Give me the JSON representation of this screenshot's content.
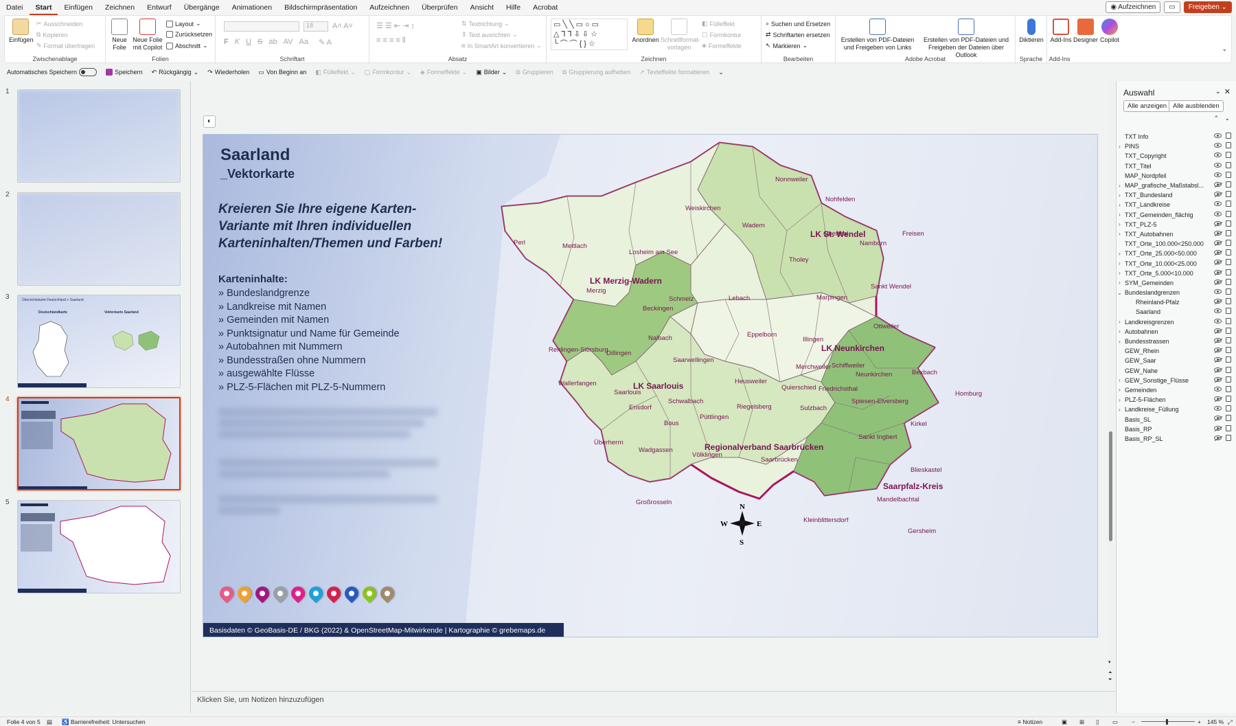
{
  "menu": {
    "tabs": [
      "Datei",
      "Start",
      "Einfügen",
      "Zeichnen",
      "Entwurf",
      "Übergänge",
      "Animationen",
      "Bildschirmpräsentation",
      "Aufzeichnen",
      "Überprüfen",
      "Ansicht",
      "Hilfe",
      "Acrobat"
    ],
    "active_tab": "Start",
    "record_label": "Aufzeichnen",
    "share_label": "Freigeben"
  },
  "ribbon": {
    "clipboard": {
      "group": "Zwischenablage",
      "paste": "Einfügen",
      "cut": "Ausschneiden",
      "copy": "Kopieren",
      "format_painter": "Format übertragen"
    },
    "slides": {
      "group": "Folien",
      "new_slide": "Neue Folie",
      "new_slide_copilot": "Neue Folie mit Copilot",
      "layout": "Layout",
      "reset": "Zurücksetzen",
      "section": "Abschnitt"
    },
    "font": {
      "group": "Schriftart",
      "size": "18",
      "bold": "F",
      "italic": "K",
      "underline": "U",
      "strike": "S",
      "shadow": "ab",
      "spacing": "AV",
      "case": "Aa"
    },
    "paragraph": {
      "group": "Absatz",
      "text_direction": "Textrichtung",
      "align_text": "Text ausrichten",
      "smartart": "In SmartArt konvertieren"
    },
    "drawing": {
      "group": "Zeichnen",
      "arrange": "Anordnen",
      "quick_styles": "Schnellformat-vorlagen",
      "fill": "Fülleffekt",
      "outline": "Formkontur",
      "effects": "Formeffekte"
    },
    "editing": {
      "group": "Bearbeiten",
      "find": "Suchen und Ersetzen",
      "replace": "Schriftarten ersetzen",
      "select": "Markieren"
    },
    "acrobat": {
      "group": "Adobe Acrobat",
      "pdf_share_links": "Erstellen von PDF-Dateien und Freigeben von Links",
      "pdf_share_outlook": "Erstellen von PDF-Dateien und Freigeben der Dateien über Outlook"
    },
    "voice": {
      "group": "Sprache",
      "dictate": "Diktieren"
    },
    "addins": {
      "group": "Add-Ins",
      "addins": "Add-Ins",
      "designer": "Designer",
      "copilot": "Copilot"
    }
  },
  "quickbar": {
    "autosave": "Automatisches Speichern",
    "save": "Speichern",
    "undo": "Rückgängig",
    "redo": "Wiederholen",
    "from_start": "Von Beginn an",
    "fill": "Fülleffekt",
    "outline": "Formkontur",
    "effects": "Formeffekte",
    "pictures": "Bilder",
    "group": "Gruppieren",
    "ungroup": "Gruppierung aufheben",
    "text_effects": "Texteffekte formatieren"
  },
  "thumbnails": {
    "numbers": [
      "1",
      "2",
      "3",
      "4",
      "5"
    ],
    "t3_title": "Übersichtskarte Deutschland + Saarland",
    "t3_left": "Deutschlandkarte",
    "t3_right": "Vektorkarte Saarland"
  },
  "slide": {
    "title": "Saarland",
    "subtitle": "_Vektorkarte",
    "claim": "Kreieren Sie Ihre eigene Karten-Variante mit Ihren individuellen Karteninhalten/Themen und Farben!",
    "content_head": "Karteninhalte:",
    "content_items": [
      "» Bundeslandgrenze",
      "» Landkreise mit Namen",
      "» Gemeinden mit Namen",
      "» Punktsignatur und Name für Gemeinde",
      "» Autobahnen mit Nummern",
      "» Bundesstraßen ohne Nummern",
      "» ausgewählte Flüsse",
      "» PLZ-5-Flächen mit PLZ-5-Nummern"
    ],
    "footer": "Basisdaten © GeoBasis-DE / BKG (2022) & OpenStreetMap-Mitwirkende | Kartographie © grebemaps.de",
    "pin_colors": [
      "#e95a86",
      "#f0a030",
      "#a0187e",
      "#9aa0a6",
      "#e0208a",
      "#1ea0d8",
      "#d81e4a",
      "#2a58c0",
      "#8ac41e",
      "#a08a6a"
    ],
    "compass": {
      "n": "N",
      "s": "S",
      "e": "E",
      "w": "W"
    }
  },
  "map": {
    "districts": [
      "LK St. Wendel",
      "LK Merzig-Wadern",
      "LK Neunkirchen",
      "LK Saarlouis",
      "Regionalverband Saarbrücken",
      "Saarpfalz-Kreis"
    ],
    "municipalities": [
      "Nonnweiler",
      "Nohfelden",
      "Weiskirchen",
      "Wadern",
      "Oberthal",
      "Namborn",
      "Freisen",
      "Perl",
      "Mettlach",
      "Losheim am See",
      "Tholey",
      "Merzig",
      "Marpingen",
      "Sankt Wendel",
      "Schmelz",
      "Lebach",
      "Beckingen",
      "Eppelborn",
      "Ottweiler",
      "Illingen",
      "Nalbach",
      "Rehlingen-Siersburg",
      "Dillingen",
      "Saarwellingen",
      "Merchweiler",
      "Schiffweiler",
      "Wallerfangen",
      "Neunkirchen",
      "Bexbach",
      "Heusweiler",
      "Quierschied",
      "Friedrichsthal",
      "Saarlouis",
      "Schwalbach",
      "Ensdorf",
      "Spiesen-Elversberg",
      "Homburg",
      "Püttlingen",
      "Riegelsberg",
      "Sulzbach",
      "Bous",
      "Sankt Ingbert",
      "Kirkel",
      "Überherrn",
      "Wadgassen",
      "Völklingen",
      "Saarbrücken",
      "Blieskastel",
      "Großrosseln",
      "Mandelbachtal",
      "Kleinblittersdorf",
      "Gersheim"
    ]
  },
  "pane": {
    "title": "Auswahl",
    "show_all": "Alle anzeigen",
    "hide_all": "Alle ausblenden",
    "layers": [
      {
        "name": "TXT Info",
        "exp": "",
        "vis": true
      },
      {
        "name": "PINS",
        "exp": "›",
        "vis": true
      },
      {
        "name": "TXT_Copyright",
        "exp": "",
        "vis": true
      },
      {
        "name": "TXT_Titel",
        "exp": "",
        "vis": true
      },
      {
        "name": "MAP_Nordpfeil",
        "exp": "",
        "vis": true
      },
      {
        "name": "MAP_grafische_Maßstabsl...",
        "exp": "›",
        "vis": false
      },
      {
        "name": "TXT_Bundesland",
        "exp": "›",
        "vis": false
      },
      {
        "name": "TXT_Landkreise",
        "exp": "›",
        "vis": true
      },
      {
        "name": "TXT_Gemeinden_flächig",
        "exp": "›",
        "vis": true
      },
      {
        "name": "TXT_PLZ-5",
        "exp": "›",
        "vis": false
      },
      {
        "name": "TXT_Autobahnen",
        "exp": "›",
        "vis": false
      },
      {
        "name": "TXT_Orte_100.000<250.000",
        "exp": "",
        "vis": false
      },
      {
        "name": "TXT_Orte_25.000<50.000",
        "exp": "›",
        "vis": false
      },
      {
        "name": "TXT_Orte_10.000<25.000",
        "exp": "›",
        "vis": false
      },
      {
        "name": "TXT_Orte_5.000<10.000",
        "exp": "›",
        "vis": false
      },
      {
        "name": "SYM_Gemeinden",
        "exp": "›",
        "vis": false
      },
      {
        "name": "Bundeslandgrenzen",
        "exp": "⌄",
        "vis": true
      },
      {
        "name": "Rheinland-Pfalz",
        "exp": "",
        "vis": false,
        "indent": true
      },
      {
        "name": "Saarland",
        "exp": "",
        "vis": true,
        "indent": true
      },
      {
        "name": "Landkreisgrenzen",
        "exp": "›",
        "vis": true
      },
      {
        "name": "Autobahnen",
        "exp": "›",
        "vis": false
      },
      {
        "name": "Bundesstrassen",
        "exp": "›",
        "vis": false
      },
      {
        "name": "GEW_Rhein",
        "exp": "",
        "vis": false
      },
      {
        "name": "GEW_Saar",
        "exp": "",
        "vis": false
      },
      {
        "name": "GEW_Nahe",
        "exp": "",
        "vis": false
      },
      {
        "name": "GEW_Sonstige_Flüsse",
        "exp": "›",
        "vis": false
      },
      {
        "name": "Gemeinden",
        "exp": "›",
        "vis": true
      },
      {
        "name": "PLZ-5-Flächen",
        "exp": "›",
        "vis": false
      },
      {
        "name": "Landkreise_Füllung",
        "exp": "›",
        "vis": true
      },
      {
        "name": "Basis_SL",
        "exp": "",
        "vis": false
      },
      {
        "name": "Basis_RP",
        "exp": "",
        "vis": false
      },
      {
        "name": "Basis_RP_SL",
        "exp": "",
        "vis": false
      }
    ]
  },
  "notes": {
    "placeholder": "Klicken Sie, um Notizen hinzuzufügen"
  },
  "status": {
    "slide": "Folie 4 von 5",
    "accessibility": "Barrierefreiheit: Untersuchen",
    "notes": "Notizen",
    "zoom": "145 %"
  },
  "colors": {
    "accent": "#c43e1c",
    "district_light": "#e9f2dc",
    "district_mid": "#c9e1ae",
    "district_dark": "#8fc278",
    "border": "#a8165f"
  }
}
